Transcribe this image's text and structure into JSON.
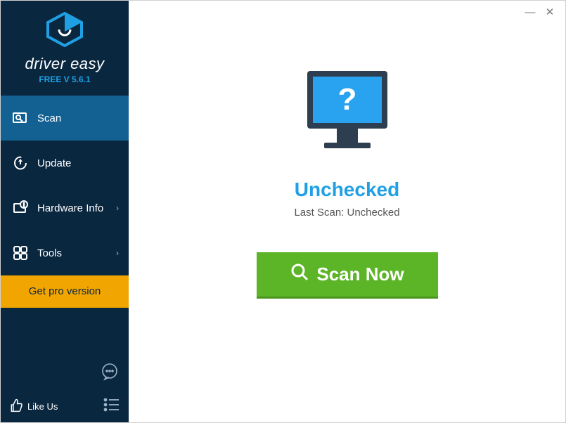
{
  "brand": {
    "name": "driver easy",
    "version": "FREE V 5.6.1"
  },
  "sidebar": {
    "items": [
      {
        "label": "Scan",
        "icon": "scan",
        "chevron": false,
        "active": true
      },
      {
        "label": "Update",
        "icon": "update",
        "chevron": false,
        "active": false
      },
      {
        "label": "Hardware Info",
        "icon": "hardware",
        "chevron": true,
        "active": false
      },
      {
        "label": "Tools",
        "icon": "tools",
        "chevron": true,
        "active": false
      }
    ],
    "pro_label": "Get pro version",
    "likeus_label": "Like Us"
  },
  "main": {
    "status_title": "Unchecked",
    "status_sub": "Last Scan: Unchecked",
    "scan_button": "Scan Now"
  },
  "titlebar": {
    "minimize": "—",
    "close": "✕"
  }
}
